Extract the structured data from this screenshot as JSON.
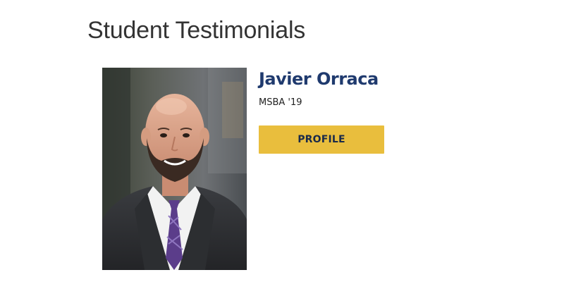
{
  "section": {
    "title": "Student Testimonials"
  },
  "testimonial": {
    "name": "Javier Orraca",
    "degree": "MSBA '19",
    "profile_button_label": "PROFILE",
    "photo_alt": "Javier Orraca"
  },
  "colors": {
    "name": "#1f3a6e",
    "button_bg": "#e9be3d",
    "button_text": "#1a2a4a",
    "title": "#333333"
  }
}
